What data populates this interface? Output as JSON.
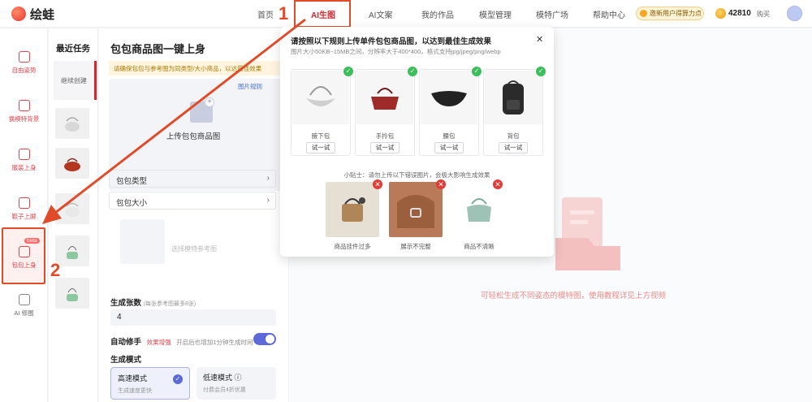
{
  "header": {
    "app_name": "绘蛙",
    "nav": [
      "首页",
      "AI生图",
      "AI文案",
      "我的作品",
      "模型管理",
      "模特广场",
      "帮助中心"
    ],
    "active_nav": "AI生图",
    "promo": "邀新用户得算力点",
    "credits": "42810",
    "buy": "购买"
  },
  "annotations": {
    "one": "1",
    "two": "2"
  },
  "sidebar": {
    "items": [
      {
        "label": "自由姿势",
        "icon": "pose-icon"
      },
      {
        "label": "换模特背景",
        "icon": "model-swap-icon"
      },
      {
        "label": "服装上身",
        "icon": "dress-icon"
      },
      {
        "label": "鞋子上脚",
        "icon": "shoe-icon"
      },
      {
        "label": "包包上身",
        "icon": "bag-icon",
        "badge": "beta"
      },
      {
        "label": "AI 修图",
        "icon": "retouch-icon"
      }
    ]
  },
  "recent": {
    "title": "最近任务",
    "continue_label": "继续创建",
    "thumb_icons": [
      "silver-bag-icon",
      "red-round-bag-icon",
      "white-bag-icon",
      "green-bag-icon",
      "green-bag-icon"
    ]
  },
  "panel": {
    "title": "包包商品图一键上身",
    "warning": "请确保包包与参考图为同类型/大小商品，以达最佳效果",
    "rules_link": "图片规则",
    "upload_label": "上传包包商品图",
    "bag_type": "包包类型",
    "bag_size": "包包大小",
    "ref_placeholder": "选择模特参考图",
    "count_label": "生成张数",
    "count_hint": "(每张参考图最多8张)",
    "count_value": "4",
    "auto_fix_label": "自动修手",
    "auto_fix_badge": "效果增强",
    "auto_fix_desc": "开启后也增加1分钟生成时间",
    "mode_label": "生成模式",
    "modes": [
      {
        "name": "高速模式",
        "desc": "生成速度更快",
        "selected": true
      },
      {
        "name": "低速模式 ⓘ",
        "desc": "付费会员4折优惠",
        "selected": false
      }
    ]
  },
  "popover": {
    "title": "请按照以下规则上传单件包包商品图，以达到最佳生成效果",
    "subtitle": "图片大小50KB~15MB之间，分辨率大于400*400，格式支持jpg/jpeg/png/webp",
    "good_examples": [
      {
        "name": "腋下包",
        "button": "试一试"
      },
      {
        "name": "手拎包",
        "button": "试一试"
      },
      {
        "name": "腰包",
        "button": "试一试"
      },
      {
        "name": "背包",
        "button": "试一试"
      }
    ],
    "tip": "小贴士：请勿上传以下错误图片，会极大影响生成效果",
    "bad_examples": [
      {
        "name": "商品挂件过多"
      },
      {
        "name": "展示不完整"
      },
      {
        "name": "商品不清晰"
      }
    ]
  },
  "main": {
    "empty_text": "可轻松生成不同姿态的模特图，使用教程详见上方视频"
  },
  "colors": {
    "accent": "#d8252c",
    "annotation": "#e04b2a",
    "toggle": "#5b6ad8"
  }
}
